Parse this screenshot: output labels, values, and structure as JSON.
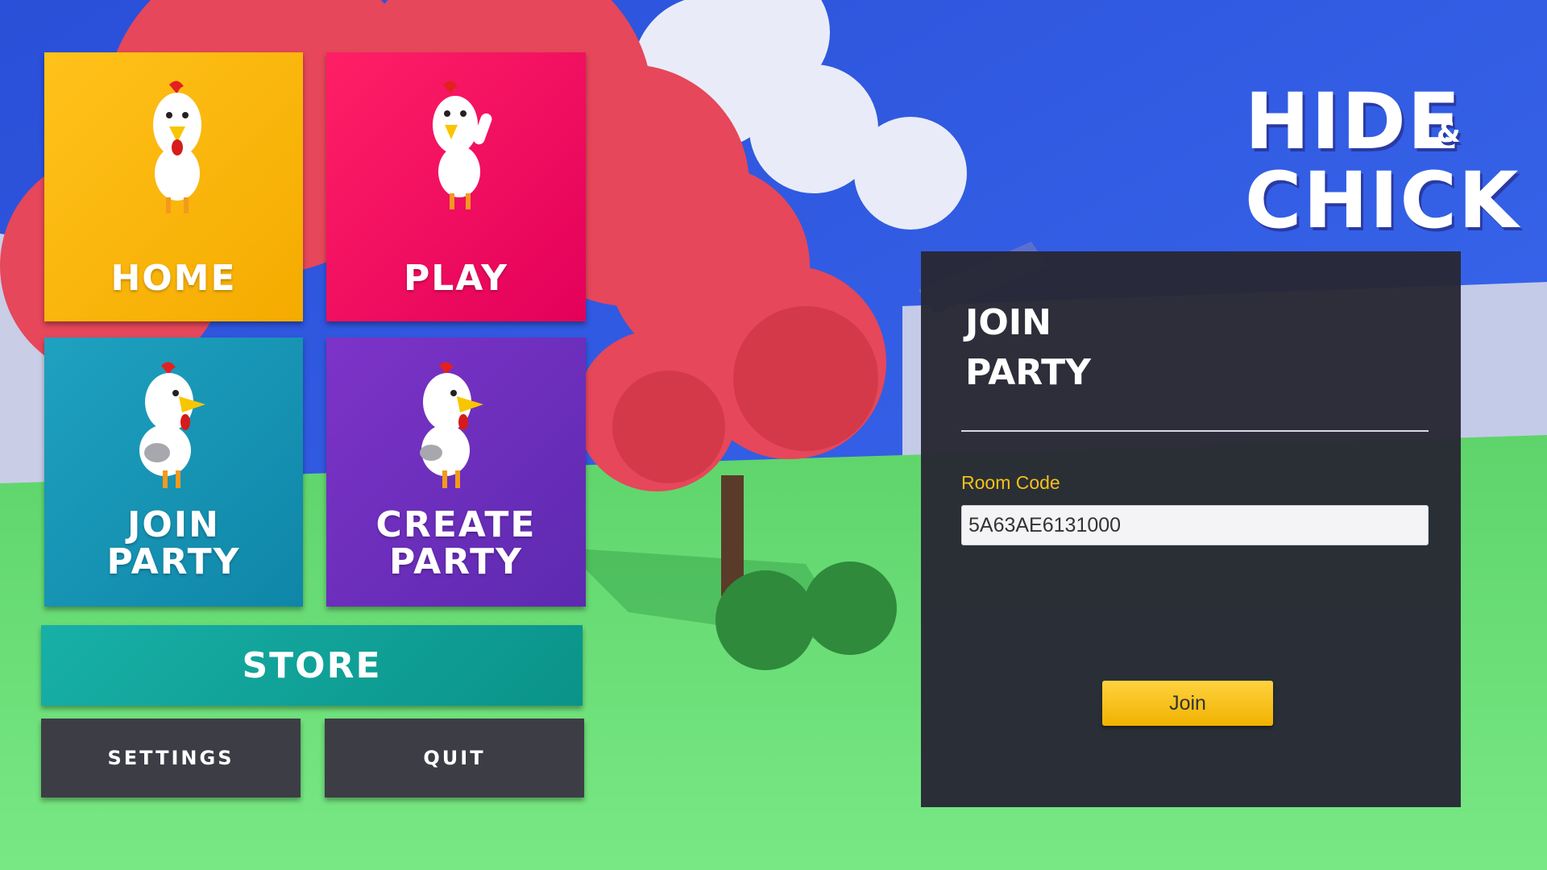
{
  "menu": {
    "home_label": "HOME",
    "play_label": "PLAY",
    "join_party_line1": "JOIN",
    "join_party_line2": "PARTY",
    "create_party_line1": "CREATE",
    "create_party_line2": "PARTY",
    "store_label": "STORE",
    "settings_label": "SETTINGS",
    "quit_label": "QUIT"
  },
  "logo": {
    "line1": "HIDE",
    "ampersand": "&",
    "line2": "CHICK"
  },
  "join_panel": {
    "title_line1": "JOIN",
    "title_line2": "PARTY",
    "room_code_label": "Room Code",
    "room_code_value": "5A63AE6131000",
    "join_button_label": "Join"
  },
  "colors": {
    "home": "#f5ab00",
    "play": "#e3005a",
    "join_party": "#0f86a8",
    "create_party": "#5d2ab0",
    "store": "#0a9389",
    "panel": "#282834",
    "accent_yellow": "#f5c01a",
    "sky": "#2f5fe0",
    "grass": "#6fe07a"
  }
}
